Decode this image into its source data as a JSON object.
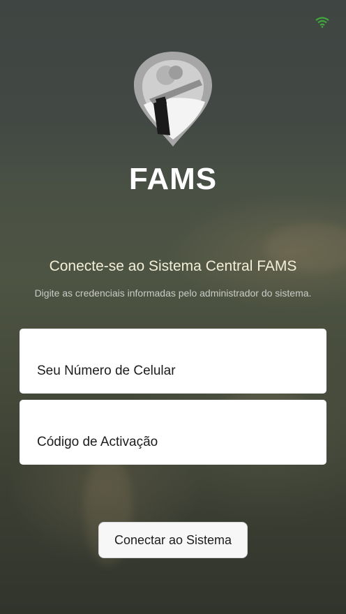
{
  "status_bar": {
    "wifi_icon": "wifi-icon",
    "wifi_color": "#3fa93a"
  },
  "logo": {
    "icon": "map-pin-farm-logo"
  },
  "brand": {
    "name": "FAMS"
  },
  "login": {
    "headline": "Conecte-se ao Sistema Central FAMS",
    "subtitle": "Digite as credenciais informadas pelo administrador do sistema.",
    "phone_placeholder": "Seu Número de Celular",
    "code_placeholder": "Código de Activação",
    "connect_label": "Conectar ao Sistema"
  },
  "colors": {
    "headline": "#f3efd8",
    "field_bg": "#ffffff",
    "button_bg": "#f7f7f7"
  }
}
